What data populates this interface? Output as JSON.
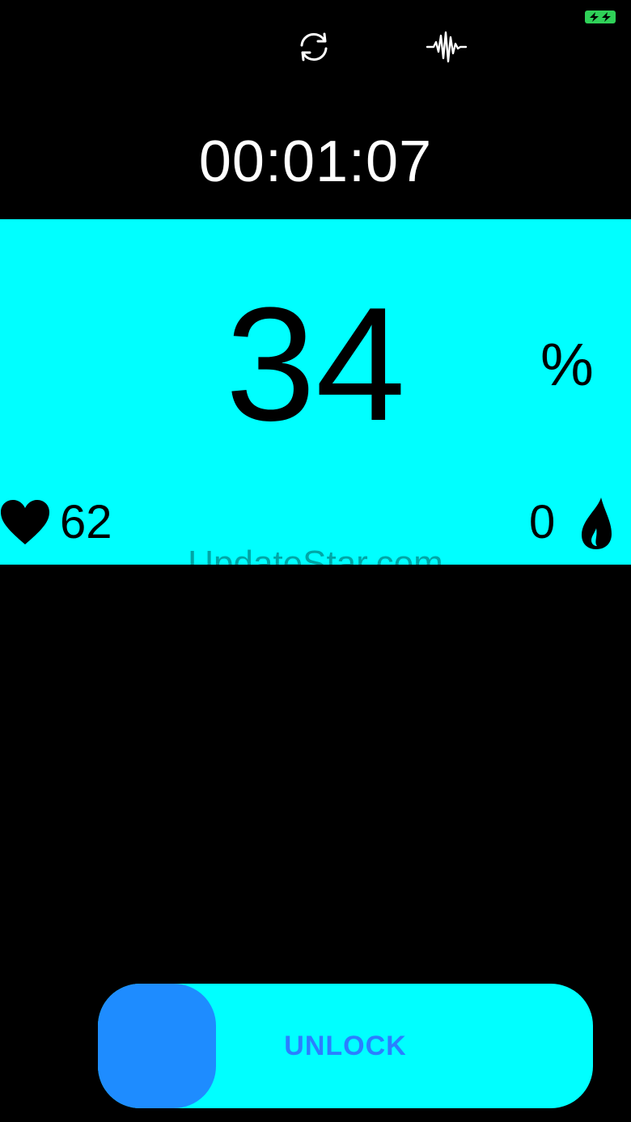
{
  "status_bar": {
    "battery_color": "#2fd158",
    "battery_icon": "charging-battery-icon"
  },
  "toolbar": {
    "sync_icon": "sync-icon",
    "waveform_icon": "waveform-icon"
  },
  "timer": {
    "elapsed": "00:01:07"
  },
  "metrics": {
    "panel_color": "#00ffff",
    "main_value": "34",
    "main_unit": "%",
    "heart_rate": "62",
    "drops": "0"
  },
  "watermark": "UpdateStar.com",
  "unlock": {
    "label": "UNLOCK",
    "track_color": "#00ffff",
    "knob_color": "#1e8cff"
  }
}
